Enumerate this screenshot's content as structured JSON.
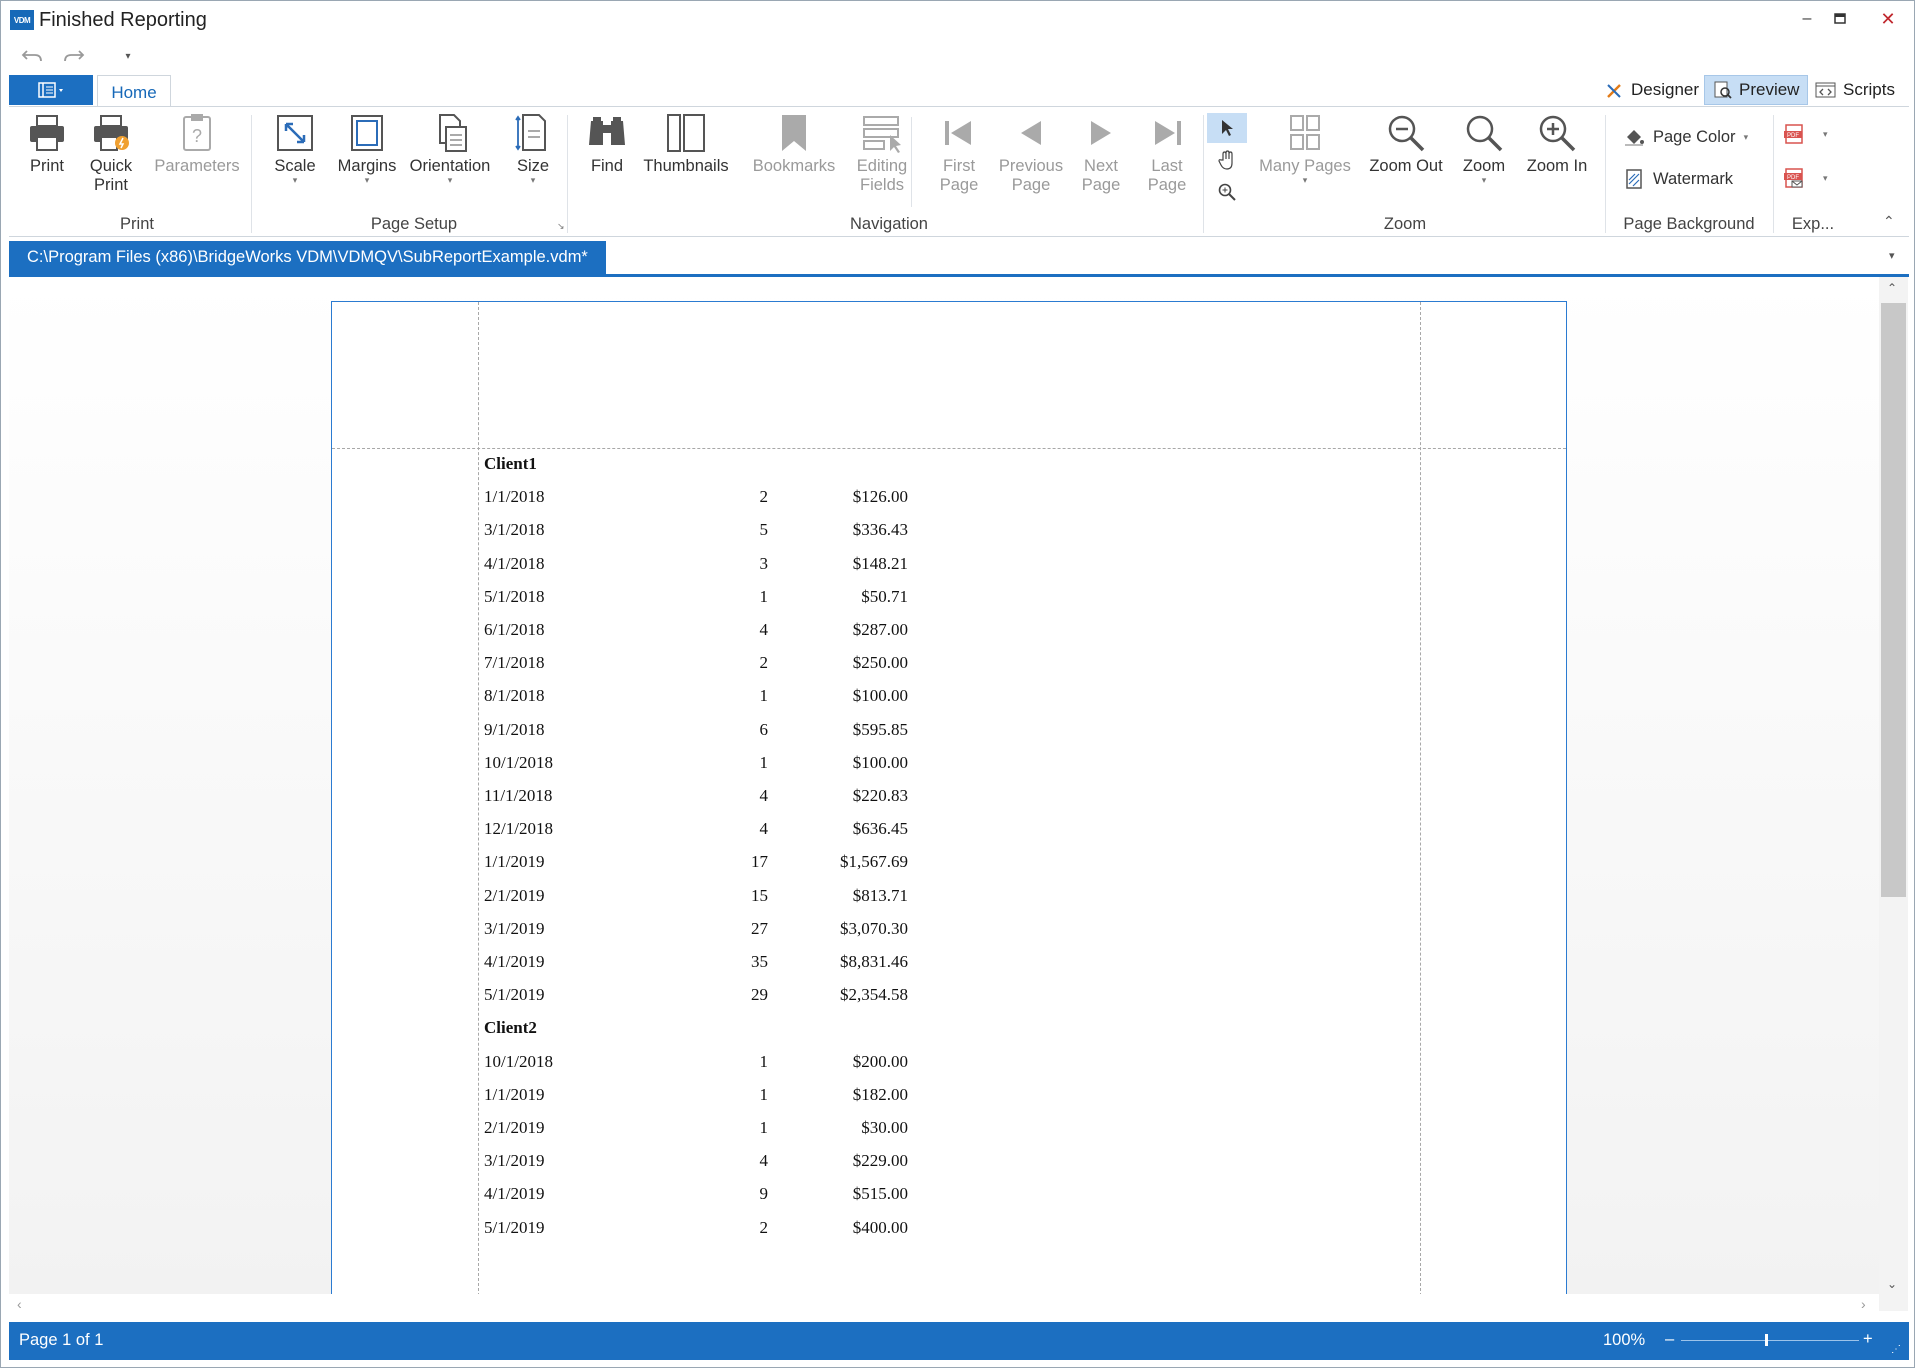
{
  "window": {
    "logo_text": "VDM",
    "title": "Finished Reporting",
    "controls": {
      "minimize": "–",
      "maximize": "▫",
      "close": "✕"
    }
  },
  "qat": {
    "dropdown": "▾"
  },
  "tabs": {
    "home": "Home",
    "modes": [
      {
        "label": "Designer",
        "icon": "designer-icon"
      },
      {
        "label": "Preview",
        "icon": "preview-icon",
        "active": true
      },
      {
        "label": "Scripts",
        "icon": "scripts-icon"
      }
    ]
  },
  "ribbon": {
    "groups": {
      "print": "Print",
      "page_setup": "Page Setup",
      "navigation": "Navigation",
      "zoom": "Zoom",
      "page_background": "Page Background",
      "export": "Exp..."
    },
    "print": {
      "print": "Print",
      "quick_print_1": "Quick",
      "quick_print_2": "Print",
      "parameters": "Parameters"
    },
    "page_setup": {
      "scale": "Scale",
      "margins": "Margins",
      "orientation": "Orientation",
      "size": "Size"
    },
    "navigation": {
      "find": "Find",
      "thumbnails": "Thumbnails",
      "bookmarks": "Bookmarks",
      "editing_fields_1": "Editing",
      "editing_fields_2": "Fields",
      "first_page_1": "First",
      "first_page_2": "Page",
      "previous_page_1": "Previous",
      "previous_page_2": "Page",
      "next_page_1": "Next",
      "next_page_2": "Page",
      "last_page_1": "Last",
      "last_page_2": "Page"
    },
    "zoom": {
      "many_pages": "Many Pages",
      "zoom_out": "Zoom Out",
      "zoom": "Zoom",
      "zoom_in": "Zoom In"
    },
    "page_background": {
      "page_color": "Page Color",
      "watermark": "Watermark"
    }
  },
  "document_tab": "C:\\Program Files (x86)\\BridgeWorks VDM\\VDMQV\\SubReportExample.vdm*",
  "report": {
    "clients": [
      {
        "name": "Client1",
        "rows": [
          {
            "date": "1/1/2018",
            "count": "2",
            "amount": "$126.00"
          },
          {
            "date": "3/1/2018",
            "count": "5",
            "amount": "$336.43"
          },
          {
            "date": "4/1/2018",
            "count": "3",
            "amount": "$148.21"
          },
          {
            "date": "5/1/2018",
            "count": "1",
            "amount": "$50.71"
          },
          {
            "date": "6/1/2018",
            "count": "4",
            "amount": "$287.00"
          },
          {
            "date": "7/1/2018",
            "count": "2",
            "amount": "$250.00"
          },
          {
            "date": "8/1/2018",
            "count": "1",
            "amount": "$100.00"
          },
          {
            "date": "9/1/2018",
            "count": "6",
            "amount": "$595.85"
          },
          {
            "date": "10/1/2018",
            "count": "1",
            "amount": "$100.00"
          },
          {
            "date": "11/1/2018",
            "count": "4",
            "amount": "$220.83"
          },
          {
            "date": "12/1/2018",
            "count": "4",
            "amount": "$636.45"
          },
          {
            "date": "1/1/2019",
            "count": "17",
            "amount": "$1,567.69"
          },
          {
            "date": "2/1/2019",
            "count": "15",
            "amount": "$813.71"
          },
          {
            "date": "3/1/2019",
            "count": "27",
            "amount": "$3,070.30"
          },
          {
            "date": "4/1/2019",
            "count": "35",
            "amount": "$8,831.46"
          },
          {
            "date": "5/1/2019",
            "count": "29",
            "amount": "$2,354.58"
          }
        ]
      },
      {
        "name": "Client2",
        "rows": [
          {
            "date": "10/1/2018",
            "count": "1",
            "amount": "$200.00"
          },
          {
            "date": "1/1/2019",
            "count": "1",
            "amount": "$182.00"
          },
          {
            "date": "2/1/2019",
            "count": "1",
            "amount": "$30.00"
          },
          {
            "date": "3/1/2019",
            "count": "4",
            "amount": "$229.00"
          },
          {
            "date": "4/1/2019",
            "count": "9",
            "amount": "$515.00"
          },
          {
            "date": "5/1/2019",
            "count": "2",
            "amount": "$400.00"
          }
        ]
      }
    ]
  },
  "status": {
    "page": "Page 1 of 1",
    "zoom": "100%",
    "zoom_minus": "–",
    "zoom_plus": "+"
  }
}
